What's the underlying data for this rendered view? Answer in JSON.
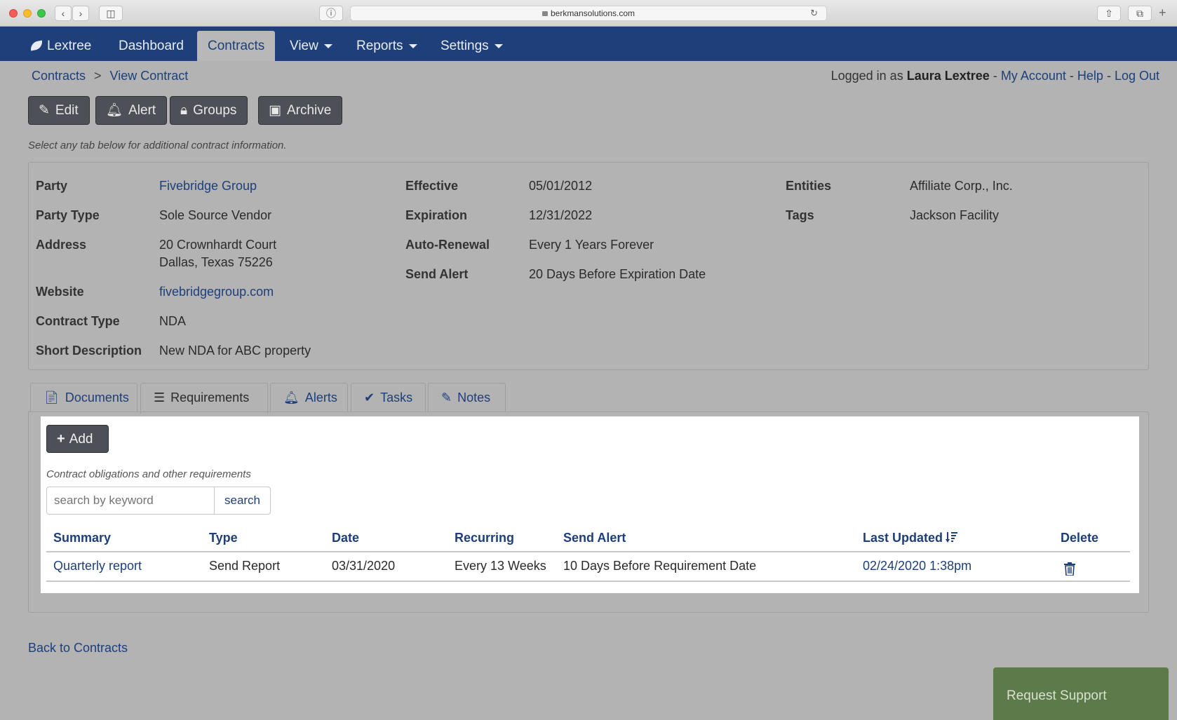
{
  "browser": {
    "url": "berkmansolutions.com"
  },
  "nav": {
    "brand": "Lextree",
    "items": [
      {
        "label": "Dashboard"
      },
      {
        "label": "Contracts"
      },
      {
        "label": "View"
      },
      {
        "label": "Reports"
      },
      {
        "label": "Settings"
      }
    ]
  },
  "breadcrumb": {
    "root": "Contracts",
    "separator": ">",
    "current": "View Contract"
  },
  "login": {
    "prefix": "Logged in as",
    "user": "Laura Lextree",
    "dash": "-",
    "my_account": "My Account",
    "help": "Help",
    "logout": "Log Out"
  },
  "actions": {
    "edit": "Edit",
    "alert": "Alert",
    "groups": "Groups",
    "archive": "Archive"
  },
  "hint": "Select any tab below for additional contract information.",
  "contract": {
    "party_label": "Party",
    "party": "Fivebridge Group",
    "party_type_label": "Party Type",
    "party_type": "Sole Source Vendor",
    "address_label": "Address",
    "address_line1": "20 Crownhardt Court",
    "address_line2": "Dallas, Texas 75226",
    "website_label": "Website",
    "website": "fivebridgegroup.com",
    "contract_type_label": "Contract Type",
    "contract_type": "NDA",
    "short_desc_label": "Short Description",
    "short_desc": "New NDA for ABC property",
    "effective_label": "Effective",
    "effective": "05/01/2012",
    "expiration_label": "Expiration",
    "expiration": "12/31/2022",
    "auto_renewal_label": "Auto-Renewal",
    "auto_renewal": "Every 1 Years Forever",
    "send_alert_label": "Send Alert",
    "send_alert": "20 Days Before Expiration Date",
    "entities_label": "Entities",
    "entities": "Affiliate Corp., Inc.",
    "tags_label": "Tags",
    "tags": "Jackson Facility"
  },
  "tabs": {
    "documents": "Documents",
    "requirements": "Requirements",
    "alerts": "Alerts",
    "tasks": "Tasks",
    "notes": "Notes"
  },
  "requirements": {
    "add": "Add",
    "caption": "Contract obligations and other requirements",
    "search_placeholder": "search by keyword",
    "search_button": "search",
    "columns": {
      "summary": "Summary",
      "type": "Type",
      "date": "Date",
      "recurring": "Recurring",
      "send_alert": "Send Alert",
      "last_updated": "Last Updated",
      "delete": "Delete"
    },
    "rows": [
      {
        "summary": "Quarterly report",
        "type": "Send Report",
        "date": "03/31/2020",
        "recurring": "Every 13 Weeks",
        "send_alert": "10 Days Before Requirement Date",
        "last_updated": "02/24/2020 1:38pm"
      }
    ]
  },
  "footer": {
    "back": "Back to Contracts",
    "support": "Request Support"
  },
  "colors": {
    "nav_bg": "#1e3f79",
    "link": "#1e3f79",
    "button_dark": "#4d5057",
    "support_bg": "#5d7a4a",
    "page_bg": "#b3b3b3"
  }
}
